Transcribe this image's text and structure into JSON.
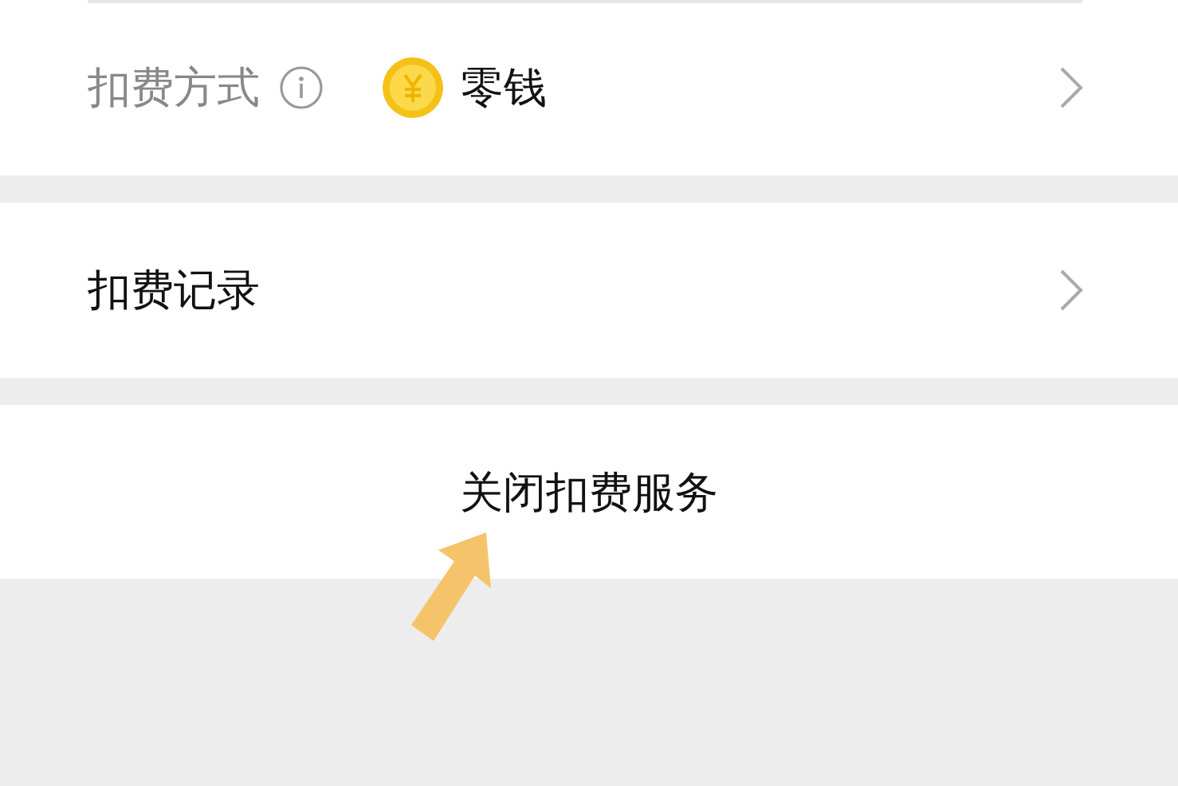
{
  "payment_method": {
    "label": "扣费方式",
    "value": "零钱"
  },
  "records": {
    "label": "扣费记录"
  },
  "close_button": {
    "label": "关闭扣费服务"
  }
}
